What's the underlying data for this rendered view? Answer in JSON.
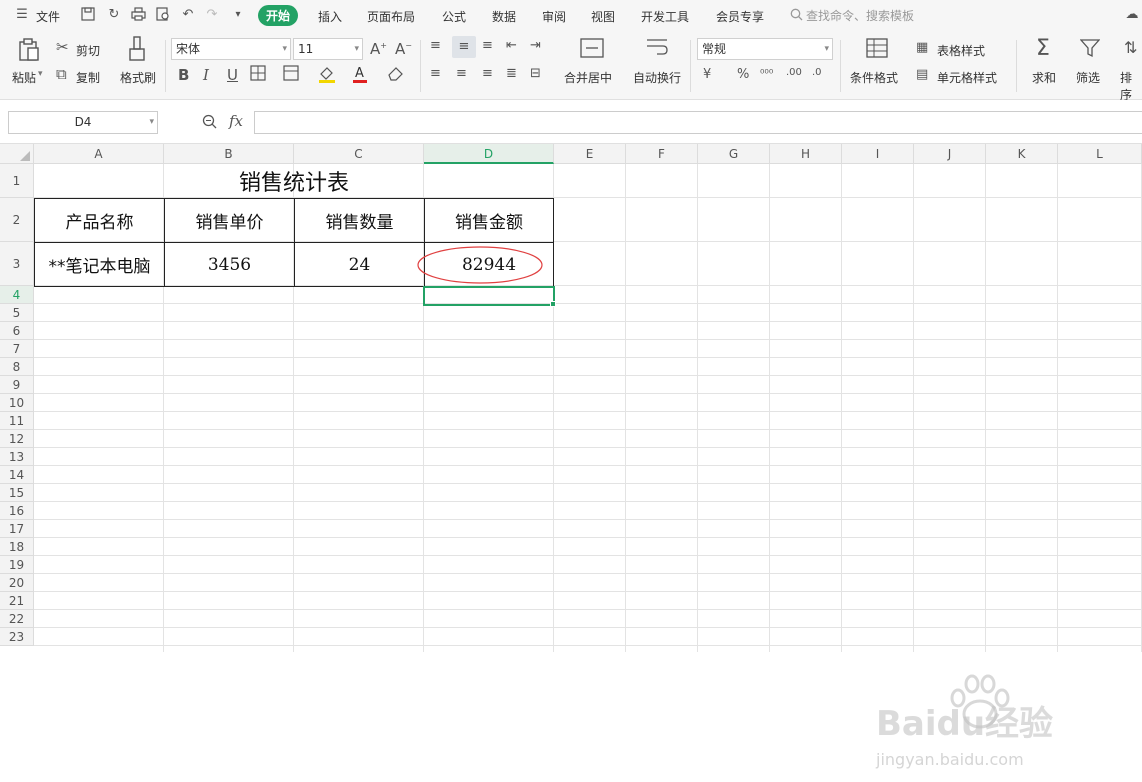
{
  "menubar": {
    "file_label": "文件",
    "tabs": [
      "开始",
      "插入",
      "页面布局",
      "公式",
      "数据",
      "审阅",
      "视图",
      "开发工具",
      "会员专享"
    ],
    "search_placeholder": "查找命令、搜索模板"
  },
  "ribbon": {
    "paste": "粘贴",
    "cut": "剪切",
    "copy": "复制",
    "format_painter": "格式刷",
    "font_name": "宋体",
    "font_size": "11",
    "merge_center": "合并居中",
    "wrap_text": "自动换行",
    "number_format": "常规",
    "conditional_format": "条件格式",
    "table_style": "表格样式",
    "cell_style": "单元格样式",
    "sum": "求和",
    "filter": "筛选",
    "sort": "排序"
  },
  "formula_bar": {
    "name_box": "D4",
    "fx_label": "fx",
    "formula": ""
  },
  "grid": {
    "columns": [
      "A",
      "B",
      "C",
      "D",
      "E",
      "F",
      "G",
      "H",
      "I",
      "J",
      "K",
      "L"
    ],
    "rows": [
      "1",
      "2",
      "3",
      "4",
      "5",
      "6",
      "7",
      "8",
      "9",
      "10",
      "11",
      "12",
      "13",
      "14",
      "15",
      "16",
      "17",
      "18",
      "19",
      "20",
      "21",
      "22",
      "23"
    ],
    "active_cell": "D4"
  },
  "sheet": {
    "title": "销售统计表",
    "headers": [
      "产品名称",
      "销售单价",
      "销售数量",
      "销售金额"
    ],
    "row": [
      "**笔记本电脑",
      "3456",
      "24",
      "82944"
    ]
  },
  "watermark": {
    "brand": "Baidu经验",
    "url": "jingyan.baidu.com"
  },
  "colors": {
    "accent": "#23a265",
    "annotation": "#e04040"
  }
}
